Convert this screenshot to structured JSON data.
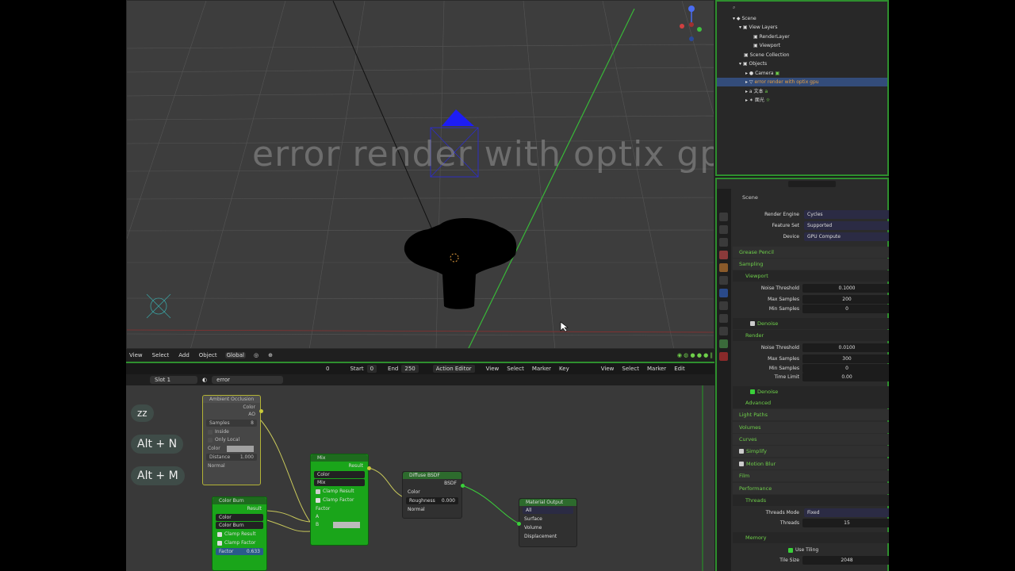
{
  "viewport": {
    "overlay_text": "error render with optix gp",
    "header": {
      "view": "View",
      "select": "Select",
      "add": "Add",
      "object": "Object",
      "orientation": "Global"
    }
  },
  "timeline": {
    "frame": "0",
    "start_label": "Start",
    "start": "0",
    "end_label": "End",
    "end": "250",
    "editor": "Action Editor",
    "view": "View",
    "select": "Select",
    "marker": "Marker",
    "key": "Key",
    "view2": "View",
    "select2": "Select",
    "marker2": "Marker",
    "edit": "Edit"
  },
  "node_header": {
    "slot": "Slot 1",
    "material": "error"
  },
  "keys": [
    "zz",
    "Alt + N",
    "Alt + M"
  ],
  "nodes": {
    "ambient": {
      "title": "Ambient Occlusion",
      "color_out": "Color",
      "ao_out": "AO",
      "samples_label": "Samples",
      "samples": "8",
      "inside": "Inside",
      "only_local": "Only Local",
      "color_in": "Color",
      "distance_label": "Distance",
      "distance": "1.000",
      "normal": "Normal"
    },
    "mix": {
      "title": "Mix",
      "result": "Result",
      "type": "Color",
      "blend": "Mix",
      "clamp_result": "Clamp Result",
      "clamp_factor": "Clamp Factor",
      "factor": "Factor",
      "a": "A",
      "b": "B"
    },
    "diffuse": {
      "title": "Diffuse BSDF",
      "bsdf": "BSDF",
      "color": "Color",
      "roughness_label": "Roughness",
      "roughness": "0.000",
      "normal": "Normal"
    },
    "output": {
      "title": "Material Output",
      "target": "All",
      "surface": "Surface",
      "volume": "Volume",
      "displacement": "Displacement"
    },
    "colorburn": {
      "title": "Color Burn",
      "result": "Result",
      "type": "Color",
      "blend": "Color Burn",
      "clamp_result": "Clamp Result",
      "clamp_factor": "Clamp Factor",
      "factor_label": "Factor",
      "factor": "0.633"
    }
  },
  "outliner": {
    "rows": [
      "Scene",
      "View Layers",
      "RenderLayer",
      "Viewport",
      "Scene Collection",
      "Objects",
      "Camera",
      "error render with optix gpu",
      "文本",
      "面光"
    ]
  },
  "props": {
    "scene": "Scene",
    "render_engine_label": "Render Engine",
    "render_engine": "Cycles",
    "feature_set_label": "Feature Set",
    "feature_set": "Supported",
    "device_label": "Device",
    "device": "GPU Compute",
    "grease_pencil": "Grease Pencil",
    "sampling": "Sampling",
    "viewport": "Viewport",
    "noise_threshold_label": "Noise Threshold",
    "vp_noise_threshold": "0.1000",
    "max_samples_label": "Max Samples",
    "vp_max_samples": "200",
    "min_samples_label": "Min Samples",
    "vp_min_samples": "0",
    "denoise": "Denoise",
    "render": "Render",
    "r_noise_threshold": "0.0100",
    "r_max_samples": "300",
    "r_min_samples": "0",
    "time_limit_label": "Time Limit",
    "time_limit": "0.00",
    "denoise2": "Denoise",
    "advanced": "Advanced",
    "light_paths": "Light Paths",
    "volumes": "Volumes",
    "curves": "Curves",
    "simplify": "Simplify",
    "motion_blur": "Motion Blur",
    "film": "Film",
    "performance": "Performance",
    "threads": "Threads",
    "threads_mode_label": "Threads Mode",
    "threads_mode": "Fixed",
    "threads_label": "Threads",
    "threads_val": "15",
    "memory": "Memory",
    "use_tiling": "Use Tiling",
    "tile_size_label": "Tile Size",
    "tile_size": "2048"
  },
  "colors": {
    "accent": "#2e8f2e",
    "node_green": "#1aa51a",
    "section_text": "#6ecf4a",
    "selected_row": "#334c7a"
  }
}
